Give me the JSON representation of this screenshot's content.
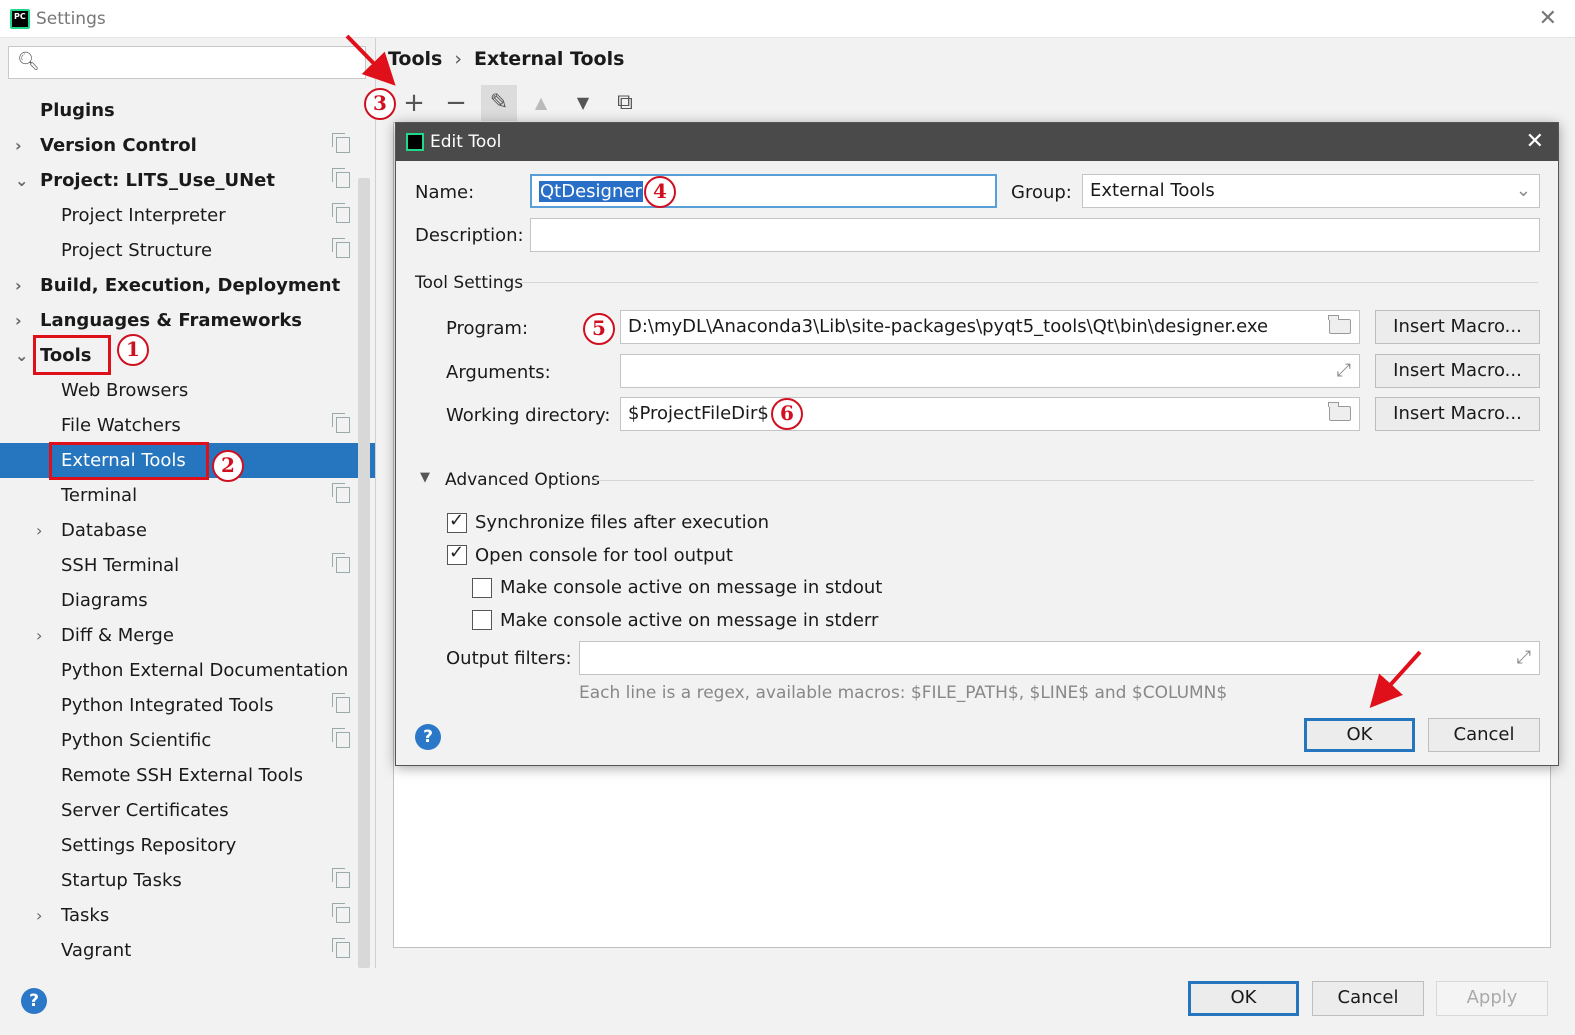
{
  "window": {
    "title": "Settings",
    "close": "✕"
  },
  "search": {
    "placeholder": ""
  },
  "sidebar": {
    "items": [
      {
        "label": "Plugins"
      },
      {
        "label": "Version Control"
      },
      {
        "label": "Project: LITS_Use_UNet"
      },
      {
        "label": "Project Interpreter"
      },
      {
        "label": "Project Structure"
      },
      {
        "label": "Build, Execution, Deployment"
      },
      {
        "label": "Languages & Frameworks"
      },
      {
        "label": "Tools"
      },
      {
        "label": "Web Browsers"
      },
      {
        "label": "File Watchers"
      },
      {
        "label": "External Tools"
      },
      {
        "label": "Terminal"
      },
      {
        "label": "Database"
      },
      {
        "label": "SSH Terminal"
      },
      {
        "label": "Diagrams"
      },
      {
        "label": "Diff & Merge"
      },
      {
        "label": "Python External Documentation"
      },
      {
        "label": "Python Integrated Tools"
      },
      {
        "label": "Python Scientific"
      },
      {
        "label": "Remote SSH External Tools"
      },
      {
        "label": "Server Certificates"
      },
      {
        "label": "Settings Repository"
      },
      {
        "label": "Startup Tasks"
      },
      {
        "label": "Tasks"
      },
      {
        "label": "Vagrant"
      }
    ]
  },
  "breadcrumb": {
    "root": "Tools",
    "sep": "›",
    "current": "External Tools"
  },
  "toolbar": {
    "add": "+",
    "remove": "−",
    "edit": "✎",
    "up": "▲",
    "down": "▼",
    "copy": "⧉"
  },
  "annotations": {
    "n1": "1",
    "n2": "2",
    "n3": "3",
    "n4": "4",
    "n5": "5",
    "n6": "6"
  },
  "dialog": {
    "title": "Edit Tool",
    "close": "✕",
    "name_label": "Name:",
    "name_value": "QtDesigner",
    "group_label": "Group:",
    "group_value": "External Tools",
    "description_label": "Description:",
    "description_value": "",
    "tool_settings": "Tool Settings",
    "program_label": "Program:",
    "program_value": "D:\\myDL\\Anaconda3\\Lib\\site-packages\\pyqt5_tools\\Qt\\bin\\designer.exe",
    "arguments_label": "Arguments:",
    "arguments_value": "",
    "workdir_label": "Working directory:",
    "workdir_value": "$ProjectFileDir$",
    "insert_macro": "Insert Macro...",
    "advanced": "Advanced Options",
    "sync_files": "Synchronize files after execution",
    "open_console": "Open console for tool output",
    "active_stdout": "Make console active on message in stdout",
    "active_stderr": "Make console active on message in stderr",
    "output_filters_label": "Output filters:",
    "output_filters_value": "",
    "hint": "Each line is a regex, available macros: $FILE_PATH$, $LINE$ and $COLUMN$",
    "ok": "OK",
    "cancel": "Cancel",
    "help": "?"
  },
  "footer": {
    "ok": "OK",
    "cancel": "Cancel",
    "apply": "Apply",
    "help": "?"
  },
  "colors": {
    "accent": "#2675bf",
    "annotation_red": "#e0101a",
    "dialog_title": "#4a4a4a"
  }
}
